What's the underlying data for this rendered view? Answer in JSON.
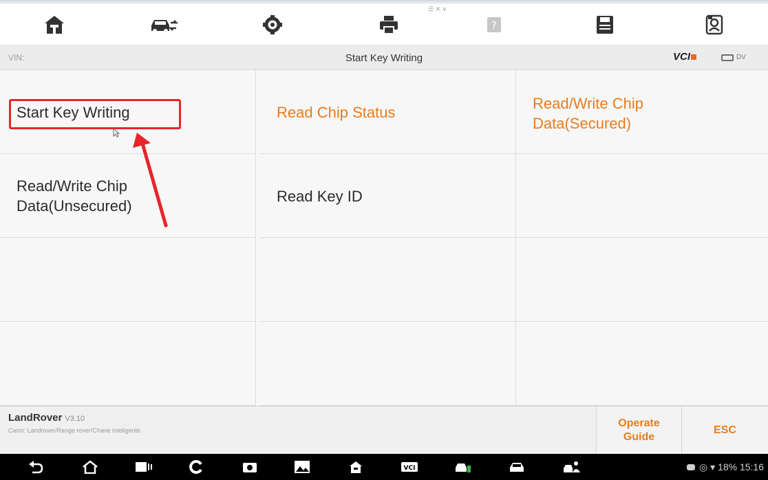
{
  "toolbar": {
    "hint": "☰ ✕ ∨",
    "icons": [
      "home-icon",
      "vehicle-swap-icon",
      "settings-gear-icon",
      "print-icon",
      "help-icon",
      "save-icon",
      "profile-icon"
    ]
  },
  "titlebar": {
    "vin_label": "VIN:",
    "title": "Start Key Writing",
    "vci_label": "VCI",
    "battery_label": "DV"
  },
  "menu": {
    "items": [
      {
        "label": "Start Key Writing",
        "color": "#2b2b2b",
        "highlighted": true
      },
      {
        "label": "Read Chip Status",
        "color": "#e97c1c"
      },
      {
        "label": "Read/Write Chip Data(Secured)",
        "color": "#e97c1c"
      },
      {
        "label": "Read/Write Chip Data(Unsecured)",
        "color": "#2b2b2b"
      },
      {
        "label": "Read Key ID",
        "color": "#2b2b2b"
      }
    ]
  },
  "annotation": {
    "color": "#e8242a"
  },
  "footer": {
    "brand": "LandRover",
    "version": "V3.10",
    "path": "Carro: Landrover/Range rover/Chave inteligente",
    "operate_guide": "Operate Guide",
    "esc": "ESC"
  },
  "system_bar": {
    "battery": "18%",
    "time": "15:16"
  },
  "colors": {
    "accent": "#e97c1c",
    "annotation_red": "#e8242a"
  }
}
